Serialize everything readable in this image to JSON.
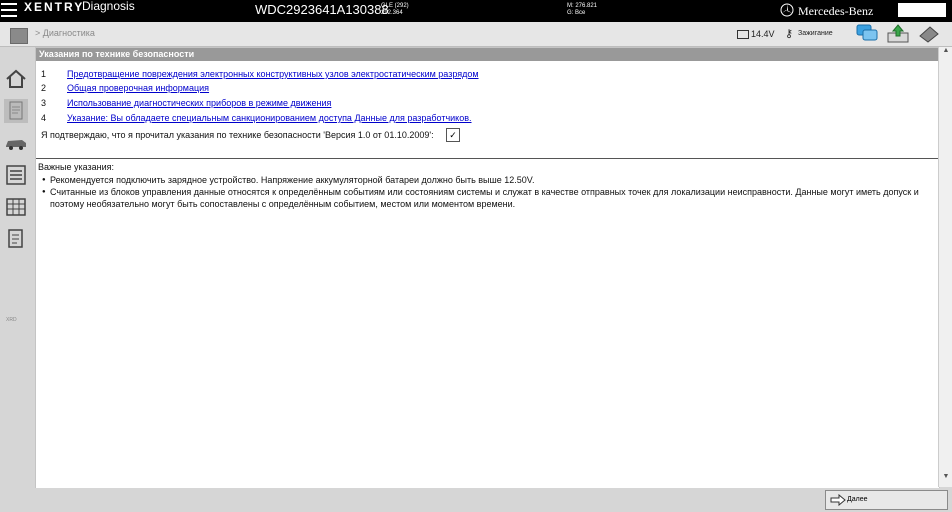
{
  "app": {
    "name": "XENTRY",
    "module": "Diagnosis",
    "vin": "WDC2923641A130388",
    "model_line1": "GLE (292)",
    "model_line2": "292.364",
    "mileage_line1": "M: 276.821",
    "mileage_line2": "G: Все",
    "brand": "Mercedes-Benz"
  },
  "subbar": {
    "breadcrumb": "> Диагностика",
    "battery_voltage": "14.4V",
    "ignition_label": "Зажигание"
  },
  "section": {
    "title": "Указания по технике безопасности",
    "items": [
      {
        "num": "1",
        "text": "Предотвращение повреждения электронных конструктивных узлов электростатическим разрядом"
      },
      {
        "num": "2",
        "text": "Общая проверочная информация"
      },
      {
        "num": "3",
        "text": "Использование диагностических приборов в режиме движения"
      },
      {
        "num": "4",
        "text": "Указание: Вы обладаете специальным санкционированием доступа Данные для разработчиков."
      }
    ],
    "confirm_text": "Я подтверждаю, что я прочитал указания по технике безопасности 'Версия 1.0 от 01.10.2009':",
    "checkbox_mark": "✓"
  },
  "notes": {
    "title": "Важные указания:",
    "items": [
      "Рекомендуется подключить зарядное устройство. Напряжение аккумуляторной батареи должно быть выше 12.50V.",
      "Считанные из блоков управления данные относятся к определённым событиям или состояниям системы и служат в качестве отправных точек для локализации неисправности. Данные могут иметь допуск и поэтому необязательно могут быть сопоставлены с определённым событием, местом или моментом времени."
    ]
  },
  "rail": {
    "xrd_label": "XRD"
  },
  "footer": {
    "next_label": "Далее"
  }
}
